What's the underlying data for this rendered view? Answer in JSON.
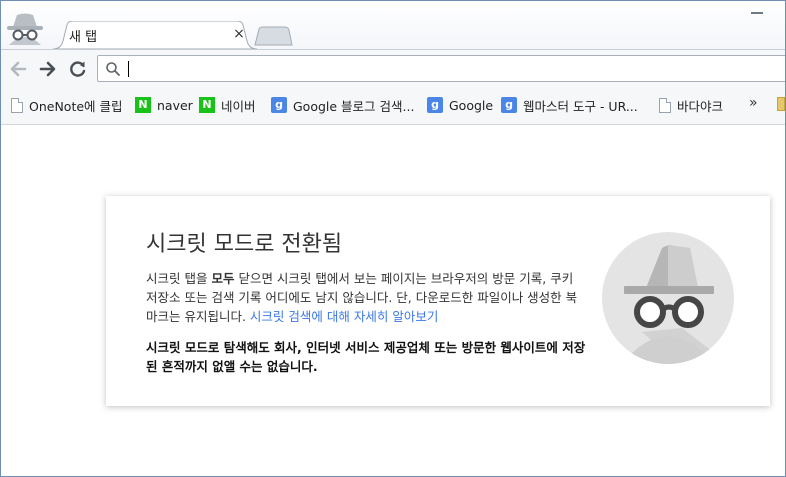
{
  "tab": {
    "title": "새 탭",
    "close_glyph": "×"
  },
  "omnibox": {
    "value": "",
    "placeholder": ""
  },
  "bookmarks": [
    {
      "label": "OneNote에 클립",
      "icon": "page-icon"
    },
    {
      "label": "naver",
      "icon": "naver-icon"
    },
    {
      "label": "네이버",
      "icon": "naver-icon"
    },
    {
      "label": "Google 블로그 검색...",
      "icon": "google-icon"
    },
    {
      "label": "Google",
      "icon": "google-icon"
    },
    {
      "label": "웹마스터 도구 - UR...",
      "icon": "google-icon"
    },
    {
      "label": "바다야크",
      "icon": "page-icon"
    }
  ],
  "bookmarks_overflow": "»",
  "icon_letters": {
    "naver": "N",
    "google": "g"
  },
  "incognito": {
    "title": "시크릿 모드로 전환됨",
    "para_part1": "시크릿 탭을 ",
    "para_bold": "모두",
    "para_part2": " 닫으면 시크릿 탭에서 보는 페이지는 브라우저의 방문 기록, 쿠키 저장소 또는 검색 기록 어디에도 남지 않습니다. 단, 다운로드한 파일이나 생성한 북마크는 유지됩니다. ",
    "learn_more_link": "시크릿 검색에 대해 자세히 알아보기",
    "warning": "시크릿 모드로 탐색해도 회사, 인터넷 서비스 제공업체 또는 방문한 웹사이트에 저장된 흔적까지 없앨 수는 없습니다."
  },
  "colors": {
    "link": "#3b78e7",
    "naver_green": "#19c219",
    "google_blue": "#4a86e8",
    "window_border": "#6d8fb3"
  }
}
